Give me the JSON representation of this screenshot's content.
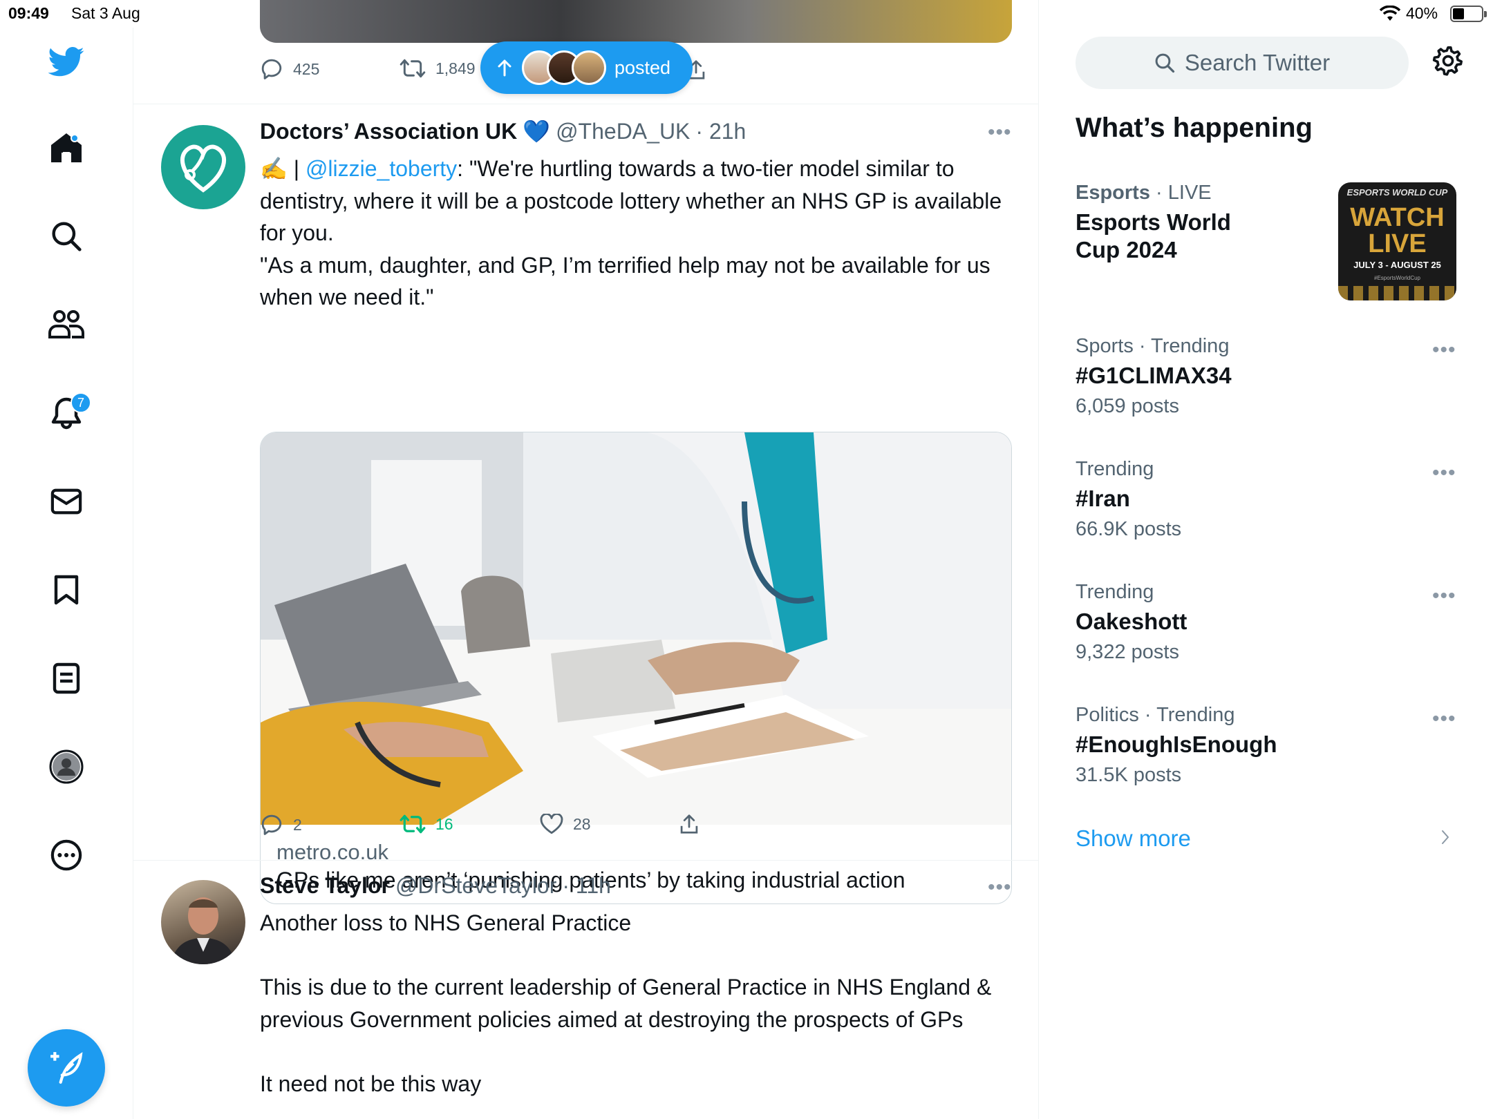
{
  "status_bar": {
    "time": "09:49",
    "date": "Sat 3 Aug",
    "battery": "40%"
  },
  "nav": {
    "notifications_count": "7",
    "items": [
      "twitter-logo",
      "home-icon",
      "search-icon",
      "communities-icon",
      "notifications-icon",
      "messages-icon",
      "bookmarks-icon",
      "lists-icon",
      "profile-icon",
      "more-icon"
    ]
  },
  "prev_tweet": {
    "replies": "425",
    "retweets": "1,849"
  },
  "new_posts_pill": {
    "label": "posted"
  },
  "tweets": [
    {
      "name": "Doctors’ Association UK",
      "verified_emoji": "💙",
      "handle": "@TheDA_UK",
      "time": "· 21h",
      "prefix": "✍️ | ",
      "mention": "@lizzie_toberty",
      "text": ": \"We're hurtling towards a two-tier model similar to dentistry, where it will be a postcode lottery whether an NHS GP is available for you.\n\"As a mum, daughter, and GP, I’m terrified help may not be available for us when we need it.\"",
      "card_domain": "metro.co.uk",
      "card_title": "GPs like me aren’t ‘punishing patients’ by taking industrial action",
      "replies": "2",
      "retweets": "16",
      "likes": "28"
    },
    {
      "name": "Steve Taylor",
      "handle": "@DrSteveTaylor",
      "time": "· 11h",
      "text": "Another loss to NHS General Practice\n\nThis is due to the current leadership of General Practice in NHS England & previous Government policies aimed at destroying the prospects of GPs\n\nIt need not be this way"
    }
  ],
  "sidebar": {
    "search_placeholder": "Search Twitter",
    "heading": "What’s happening",
    "esports": {
      "context_category": "Esports",
      "context_status": "· LIVE",
      "title": "Esports World Cup 2024",
      "image_text_top": "ESPORTS WORLD CUP",
      "image_text_main": "WATCH LIVE",
      "image_text_dates": "JULY 3 - AUGUST 25",
      "image_text_tag": "#EsportsWorldCup"
    },
    "trends": [
      {
        "context": "Sports · Trending",
        "title": "#G1CLIMAX34",
        "count": "6,059 posts"
      },
      {
        "context": "Trending",
        "title": "#Iran",
        "count": "66.9K posts"
      },
      {
        "context": "Trending",
        "title": "Oakeshott",
        "count": "9,322 posts"
      },
      {
        "context": "Politics · Trending",
        "title": "#EnoughIsEnough",
        "count": "31.5K posts"
      }
    ],
    "show_more": "Show more"
  },
  "colors": {
    "accent": "#1d9bf0",
    "retweet_green": "#00ba7c",
    "secondary_text": "#536471",
    "da_uk_avatar": "#1ba493"
  }
}
